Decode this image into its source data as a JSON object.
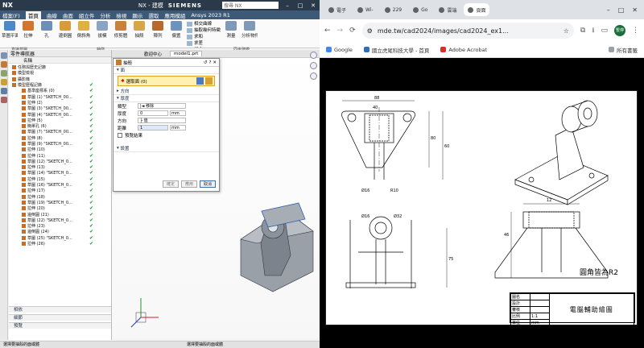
{
  "nx": {
    "logo": "NX",
    "title": "NX - 建模",
    "brand": "SIEMENS",
    "search_placeholder": "搜尋 NX",
    "quick_title": "檔案(F)",
    "menus": [
      "檔案(F)",
      "首頁",
      "曲線",
      "曲面",
      "組立件",
      "分析",
      "檢視",
      "顯示",
      "選取",
      "應用模組",
      "Ansys 2023 R1"
    ],
    "active_menu": "首頁",
    "ribbon": [
      {
        "label": "草圖平面",
        "color": "#4d89c9"
      },
      {
        "label": "拉伸",
        "color": "#d1762c"
      },
      {
        "label": "孔",
        "color": "#6b8fb9"
      },
      {
        "label": "邊倒圓",
        "color": "#d99a3a"
      },
      {
        "label": "倒斜角",
        "color": "#e0b040"
      },
      {
        "label": "拔模",
        "color": "#8aa4c4"
      },
      {
        "label": "修剪體",
        "color": "#c98338"
      },
      {
        "label": "抽殼",
        "color": "#d6a648"
      },
      {
        "label": "陣列",
        "color": "#b8682a"
      },
      {
        "label": "偏置",
        "color": "#6e93bd"
      }
    ],
    "ribbon_small": [
      "相交曲線",
      "抽取幾何特徵",
      "求和",
      "求差",
      "組合"
    ],
    "ribbon_right": [
      "測量",
      "分析物件"
    ],
    "groups": {
      "g1": "直接草圖",
      "g2": "特徵",
      "g3": "同步建模"
    },
    "nav": {
      "title": "零件導航器",
      "col": "名稱",
      "rows": [
        {
          "t": "任務與歷史記錄",
          "c": false
        },
        {
          "t": "模型檢視",
          "c": false
        },
        {
          "t": "攝影機",
          "c": false
        },
        {
          "t": "模型歷程記錄",
          "c": true
        },
        {
          "t": "基準座標系 (0)",
          "c": true
        },
        {
          "t": "草圖 (1) \"SKETCH_00...",
          "c": true
        },
        {
          "t": "拉伸 (2)",
          "c": true
        },
        {
          "t": "草圖 (3) \"SKETCH_00...",
          "c": true
        },
        {
          "t": "草圖 (4) \"SKETCH_00...",
          "c": true
        },
        {
          "t": "拉伸 (5)",
          "c": true
        },
        {
          "t": "簡單孔 (6)",
          "c": true
        },
        {
          "t": "草圖 (7) \"SKETCH_00...",
          "c": true
        },
        {
          "t": "拉伸 (8)",
          "c": true
        },
        {
          "t": "草圖 (9) \"SKETCH_00...",
          "c": true
        },
        {
          "t": "拉伸 (10)",
          "c": true
        },
        {
          "t": "拉伸 (11)",
          "c": true
        },
        {
          "t": "草圖 (12) \"SKETCH_0...",
          "c": true
        },
        {
          "t": "拉伸 (13)",
          "c": true
        },
        {
          "t": "草圖 (14) \"SKETCH_0...",
          "c": true
        },
        {
          "t": "拉伸 (15)",
          "c": true
        },
        {
          "t": "草圖 (16) \"SKETCH_0...",
          "c": true
        },
        {
          "t": "拉伸 (17)",
          "c": true
        },
        {
          "t": "拉伸 (18)",
          "c": true
        },
        {
          "t": "草圖 (19) \"SKETCH_0...",
          "c": true
        },
        {
          "t": "拉伸 (20)",
          "c": true
        },
        {
          "t": "邊倒圓 (21)",
          "c": true
        },
        {
          "t": "草圖 (22) \"SKETCH_0...",
          "c": true
        },
        {
          "t": "拉伸 (23)",
          "c": true
        },
        {
          "t": "邊倒圓 (24)",
          "c": true
        },
        {
          "t": "草圖 (25) \"SKETCH_0...",
          "c": true
        },
        {
          "t": "拉伸 (26)",
          "c": true
        }
      ],
      "bottom": [
        "相依",
        "細節",
        "預覽"
      ]
    },
    "graphics_tabs": [
      "歡迎中心",
      "model1.prt"
    ],
    "dialog": {
      "title": "抽殼",
      "sec_face": "面",
      "select_label": "選取面 (0)",
      "sec_dir": "方向",
      "sec_props": "厚度",
      "rows": [
        {
          "label": "類型",
          "value": "|◄ 移除"
        },
        {
          "label": "厚度",
          "value": "0",
          "unit": "mm"
        },
        {
          "label": "方向",
          "value": "├ 值"
        },
        {
          "label": "距離",
          "value": "1",
          "unit": "mm"
        }
      ],
      "check_label": "預覽結果",
      "sec_settings": "設置",
      "buttons": [
        "確定",
        "應用",
        "取消"
      ]
    },
    "status_left": "選擇要抽殼的面或體",
    "status_right": "選擇要抽殼的面或體"
  },
  "browser": {
    "tabs": [
      "電子",
      "Wi-",
      "229",
      "Go",
      "雲端",
      "頁面"
    ],
    "url": "mde.tw/cad2024/images/cad2024_ex1...",
    "avatar": "暫停",
    "bookmarks": [
      "Google",
      "國立虎尾科技大學 - 首頁",
      "Adobe Acrobat"
    ],
    "all_bookmarks": "所有書籤"
  },
  "drawing": {
    "note": "圓角皆為R2",
    "title_block": {
      "title": "電腦輔助繪圖",
      "labels": [
        "圖名",
        "設計",
        "審核",
        "比例",
        "單位"
      ],
      "values": [
        "",
        "",
        "",
        "1:1",
        "mm"
      ]
    },
    "dims": [
      "88",
      "40",
      "80",
      "60",
      "75",
      "Ø16",
      "Ø32",
      "Ø16",
      "R10",
      "12",
      "46"
    ]
  },
  "colors": {
    "nx_dark": "#2b3a4a",
    "nx_ribbon_tab": "#3c5a78",
    "check": "#1b9a2f",
    "select": "#fff2b0"
  }
}
